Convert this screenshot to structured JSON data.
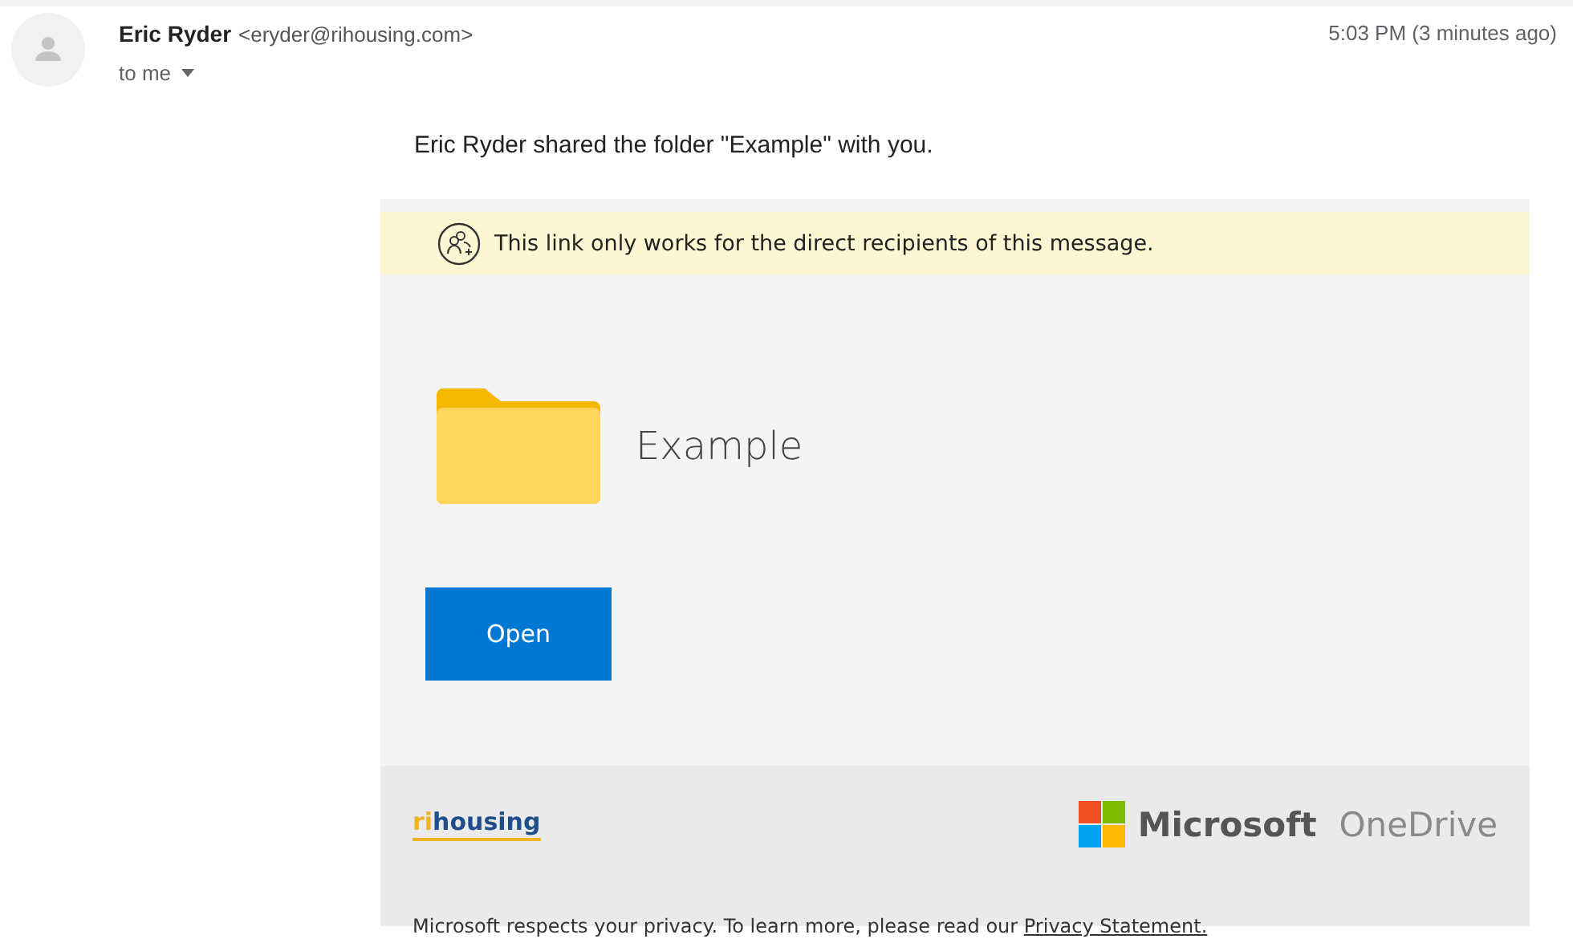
{
  "email": {
    "sender_name": "Eric Ryder",
    "sender_address": "<eryder@rihousing.com>",
    "recipient": "to me",
    "time": "5:03 PM (3 minutes ago)"
  },
  "message": "Eric Ryder shared the folder \"Example\" with you.",
  "card": {
    "notice": "This link only works for the direct recipients of this message.",
    "folder_name": "Example",
    "button": "Open",
    "footer": {
      "org_logo": [
        "ri",
        "housing"
      ],
      "brand": "Microsoft",
      "product": "OneDrive",
      "privacy_text": "Microsoft respects your privacy. To learn more, please read our ",
      "privacy_link": "Privacy Statement."
    }
  }
}
